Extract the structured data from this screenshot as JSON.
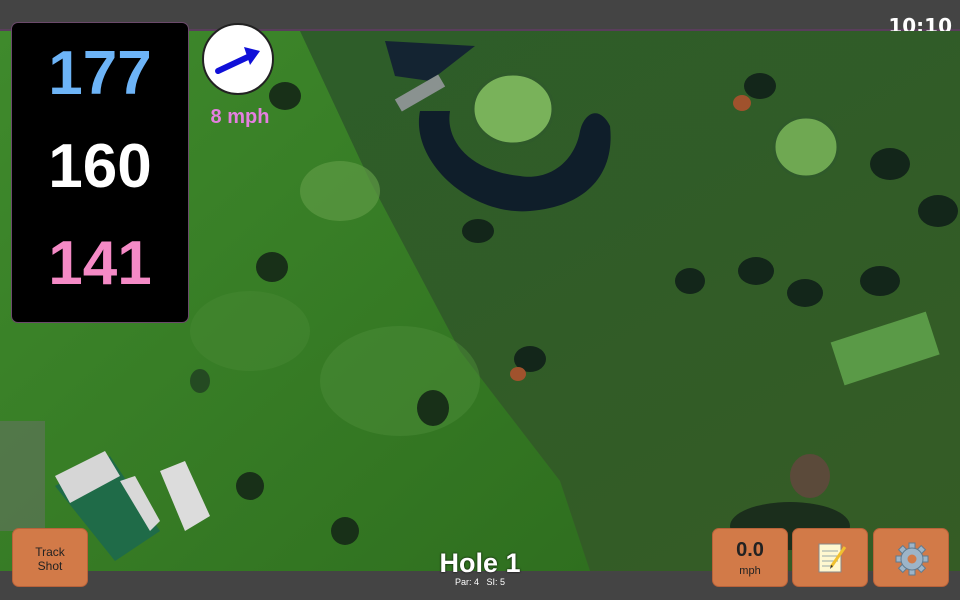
{
  "status": {
    "time": "10:10"
  },
  "distances": {
    "back": "177",
    "middle": "160",
    "front": "141"
  },
  "wind": {
    "speed": "8 mph",
    "direction_icon": "wind-arrow-icon"
  },
  "hole": {
    "title": "Hole 1",
    "par_label": "Par: 4",
    "si_label": "SI: 5"
  },
  "buttons": {
    "track_shot_line1": "Track",
    "track_shot_line2": "Shot",
    "speed_value": "0.0",
    "speed_unit": "mph",
    "notes_icon": "notepad-icon",
    "settings_icon": "gear-icon"
  },
  "colors": {
    "back_distance": "#6db4f7",
    "middle_distance": "#ffffff",
    "front_distance": "#f58ac6",
    "wind_label": "#e57fe0",
    "button": "#d27a48"
  }
}
